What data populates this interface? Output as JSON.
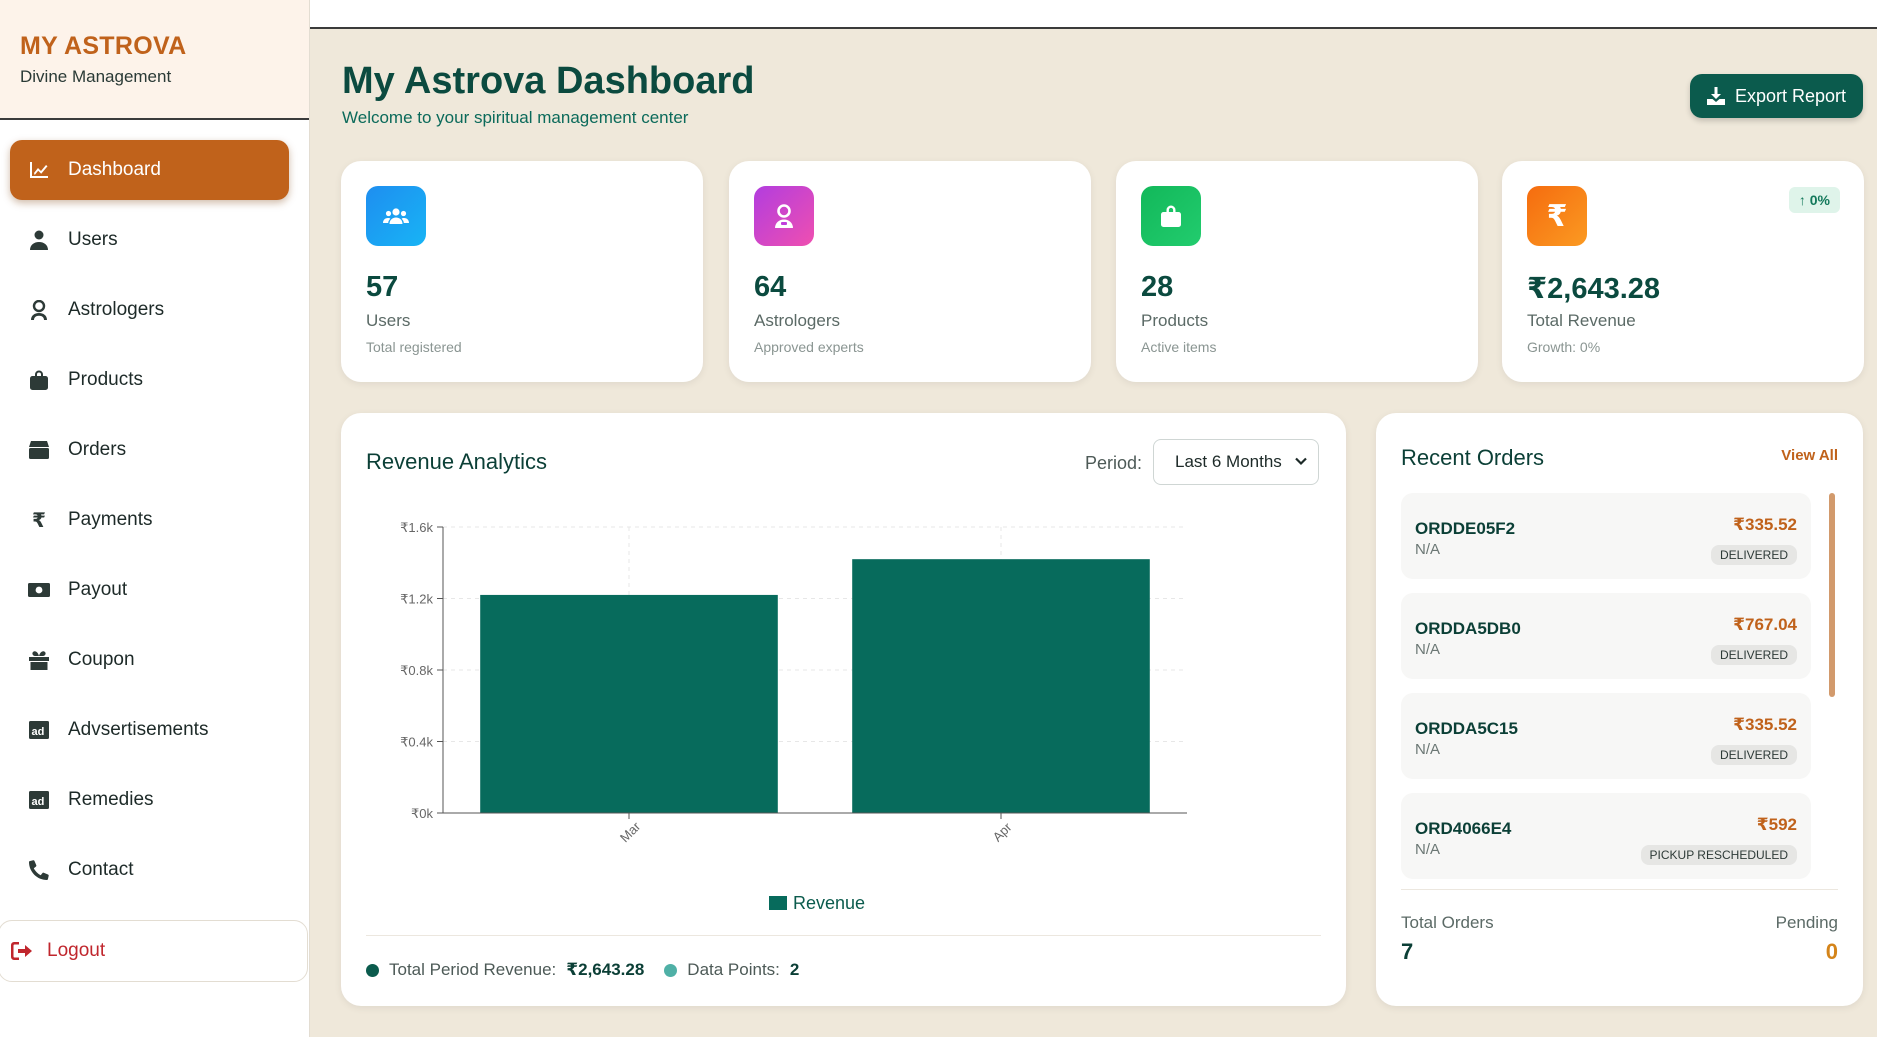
{
  "brand": {
    "title": "MY ASTROVA",
    "subtitle": "Divine Management"
  },
  "sidebar": {
    "items": [
      {
        "label": "Dashboard",
        "icon": "chart-line-icon",
        "active": true
      },
      {
        "label": "Users",
        "icon": "user-icon"
      },
      {
        "label": "Astrologers",
        "icon": "astrologer-icon"
      },
      {
        "label": "Products",
        "icon": "shopping-bag-icon"
      },
      {
        "label": "Orders",
        "icon": "box-icon"
      },
      {
        "label": "Payments",
        "icon": "rupee-icon"
      },
      {
        "label": "Payout",
        "icon": "money-bill-icon"
      },
      {
        "label": "Coupon",
        "icon": "gift-icon"
      },
      {
        "label": "Advsertisements",
        "icon": "ad-icon"
      },
      {
        "label": "Remedies",
        "icon": "ad-icon"
      },
      {
        "label": "Contact",
        "icon": "phone-icon"
      }
    ],
    "logout": "Logout"
  },
  "header": {
    "title": "My Astrova Dashboard",
    "subtitle": "Welcome to your spiritual management center",
    "export_label": "Export Report"
  },
  "stats": [
    {
      "value": "57",
      "label": "Users",
      "sub": "Total registered",
      "icon": "users-icon",
      "color": "#1e9ef0"
    },
    {
      "value": "64",
      "label": "Astrologers",
      "sub": "Approved experts",
      "icon": "astrologer-icon",
      "color": "#c03fdc"
    },
    {
      "value": "28",
      "label": "Products",
      "sub": "Active items",
      "icon": "shopping-bag-icon",
      "color": "#16c060"
    },
    {
      "value": "₹2,643.28",
      "label": "Total Revenue",
      "sub": "Growth: 0%",
      "icon": "rupee-icon",
      "color": "#f57c14",
      "growth": "↑ 0%"
    }
  ],
  "revenue": {
    "title": "Revenue Analytics",
    "period_label": "Period:",
    "period_value": "Last 6 Months",
    "total_label": "Total Period Revenue:",
    "total_value": "₹2,643.28",
    "points_label": "Data Points:",
    "points_value": "2",
    "colors": {
      "bar": "#076b5c",
      "dot_total": "#0b5b4d",
      "dot_points": "#4fb0a6"
    }
  },
  "chart_data": {
    "type": "bar",
    "categories": [
      "Mar",
      "Apr"
    ],
    "series": [
      {
        "name": "Revenue",
        "values": [
          1220,
          1420
        ]
      }
    ],
    "ylim": [
      0,
      1600
    ],
    "yticks": [
      "₹0k",
      "₹0.4k",
      "₹0.8k",
      "₹1.2k",
      "₹1.6k"
    ],
    "legend": "bottom",
    "grid": true
  },
  "orders": {
    "title": "Recent Orders",
    "view_all": "View All",
    "items": [
      {
        "id": "ORDDE05F2",
        "customer": "N/A",
        "amount": "₹335.52",
        "status": "DELIVERED"
      },
      {
        "id": "ORDDA5DB0",
        "customer": "N/A",
        "amount": "₹767.04",
        "status": "DELIVERED"
      },
      {
        "id": "ORDDA5C15",
        "customer": "N/A",
        "amount": "₹335.52",
        "status": "DELIVERED"
      },
      {
        "id": "ORD4066E4",
        "customer": "N/A",
        "amount": "₹592",
        "status": "PICKUP RESCHEDULED"
      }
    ],
    "total_label": "Total Orders",
    "total_value": "7",
    "pending_label": "Pending",
    "pending_value": "0"
  }
}
